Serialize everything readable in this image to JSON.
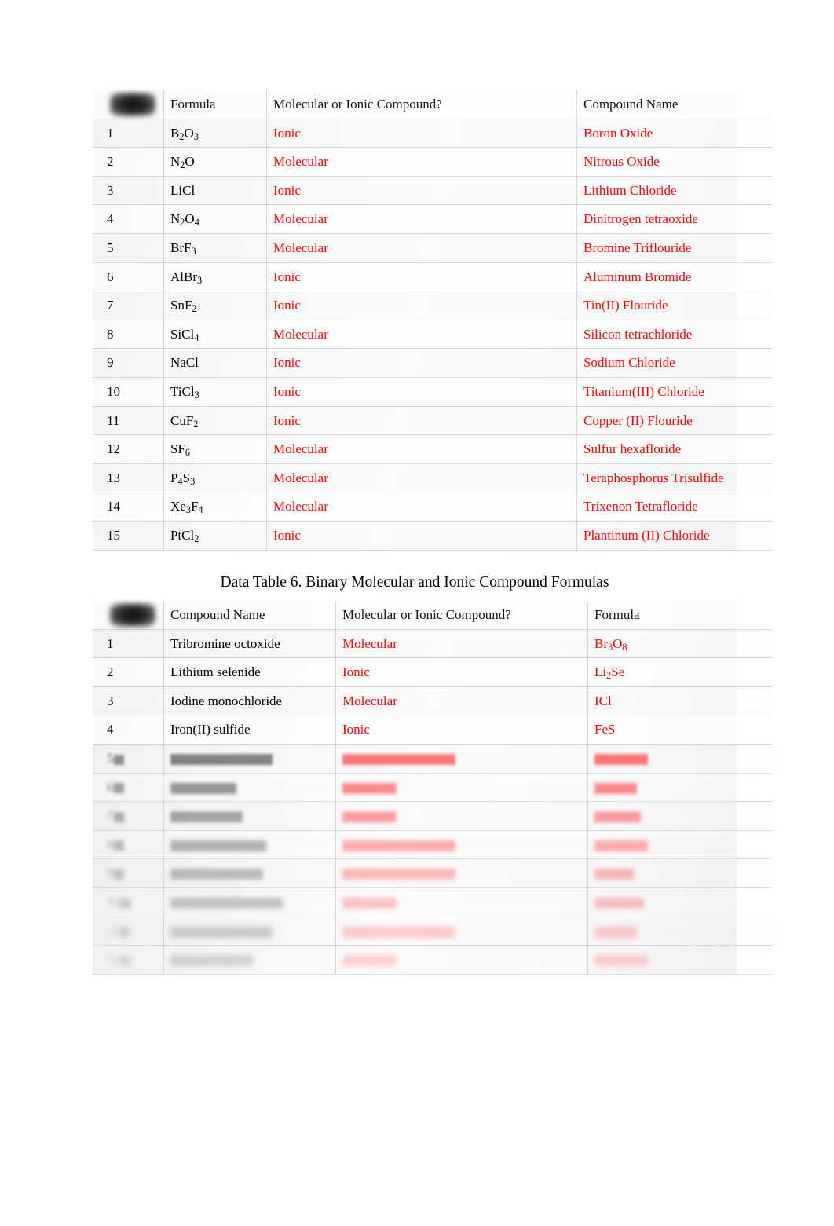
{
  "colors": {
    "answer_red": "#ff0000",
    "text_black": "#000000"
  },
  "table5": {
    "corner_cell": "redacted-box",
    "headers": {
      "num": "",
      "formula": "Formula",
      "type": "Molecular or Ionic Compound?",
      "name": "Compound Name"
    },
    "rows": [
      {
        "num": "1",
        "formula_main": "B",
        "formula": "B2O3",
        "type": "Ionic",
        "name": "Boron Oxide"
      },
      {
        "num": "2",
        "formula": "N2O",
        "type": "Molecular",
        "name": "Nitrous Oxide"
      },
      {
        "num": "3",
        "formula": "LiCl",
        "type": "Ionic",
        "name": "Lithium Chloride"
      },
      {
        "num": "4",
        "formula": "N2O4",
        "type": "Molecular",
        "name": "Dinitrogen tetraoxide"
      },
      {
        "num": "5",
        "formula": "BrF3",
        "type": "Molecular",
        "name": "Bromine Triflouride"
      },
      {
        "num": "6",
        "formula": "AlBr3",
        "type": "Ionic",
        "name": "Aluminum Bromide"
      },
      {
        "num": "7",
        "formula": "SnF2",
        "type": "Ionic",
        "name": "Tin(II) Flouride"
      },
      {
        "num": "8",
        "formula": "SiCl4",
        "type": "Molecular",
        "name": "Silicon tetrachloride"
      },
      {
        "num": "9",
        "formula": "NaCl",
        "type": "Ionic",
        "name": "Sodium Chloride"
      },
      {
        "num": "10",
        "formula": "TiCl3",
        "type": "Ionic",
        "name": "Titanium(III) Chloride"
      },
      {
        "num": "11",
        "formula": "CuF2",
        "type": "Ionic",
        "name": "Copper (II) Flouride"
      },
      {
        "num": "12",
        "formula": "SF6",
        "type": "Molecular",
        "name": "Sulfur hexafloride"
      },
      {
        "num": "13",
        "formula": "P4S3",
        "type": "Molecular",
        "name": "Teraphosphorus Trisulfide"
      },
      {
        "num": "14",
        "formula": "Xe3F4",
        "type": "Molecular",
        "name": "Trixenon Tetrafloride"
      },
      {
        "num": "15",
        "formula": "PtCl2",
        "type": "Ionic",
        "name": "Plantinum (II) Chloride"
      }
    ]
  },
  "caption6": "Data Table 6.  Binary Molecular and Ionic Compound Formulas",
  "table6": {
    "corner_cell": "redacted-box",
    "headers": {
      "num": "",
      "name": "Compound Name",
      "type": "Molecular or Ionic Compound?",
      "formula": "Formula"
    },
    "rows": [
      {
        "num": "1",
        "name": "Tribromine octoxide",
        "type": "Molecular",
        "formula": "Br3O8",
        "state": "visible"
      },
      {
        "num": "2",
        "name": "Lithium selenide",
        "type": "Ionic",
        "formula": "Li2Se",
        "state": "visible"
      },
      {
        "num": "3",
        "name": "Iodine monochloride",
        "type": "Molecular",
        "formula": "ICl",
        "state": "visible"
      },
      {
        "num": "4",
        "name": "Iron(II) sulfide",
        "type": "Ionic",
        "formula": "FeS",
        "state": "visible"
      },
      {
        "num": "5",
        "name": "",
        "type": "",
        "formula": "",
        "state": "blurred"
      },
      {
        "num": "6",
        "name": "",
        "type": "",
        "formula": "",
        "state": "blurred"
      },
      {
        "num": "7",
        "name": "",
        "type": "",
        "formula": "",
        "state": "blurred"
      },
      {
        "num": "8",
        "name": "",
        "type": "",
        "formula": "",
        "state": "blurred"
      },
      {
        "num": "9",
        "name": "",
        "type": "",
        "formula": "",
        "state": "blurred"
      },
      {
        "num": "10",
        "name": "",
        "type": "",
        "formula": "",
        "state": "blurred"
      },
      {
        "num": "11",
        "name": "",
        "type": "",
        "formula": "",
        "state": "blurred"
      },
      {
        "num": "12",
        "name": "",
        "type": "",
        "formula": "",
        "state": "blurred"
      }
    ]
  }
}
